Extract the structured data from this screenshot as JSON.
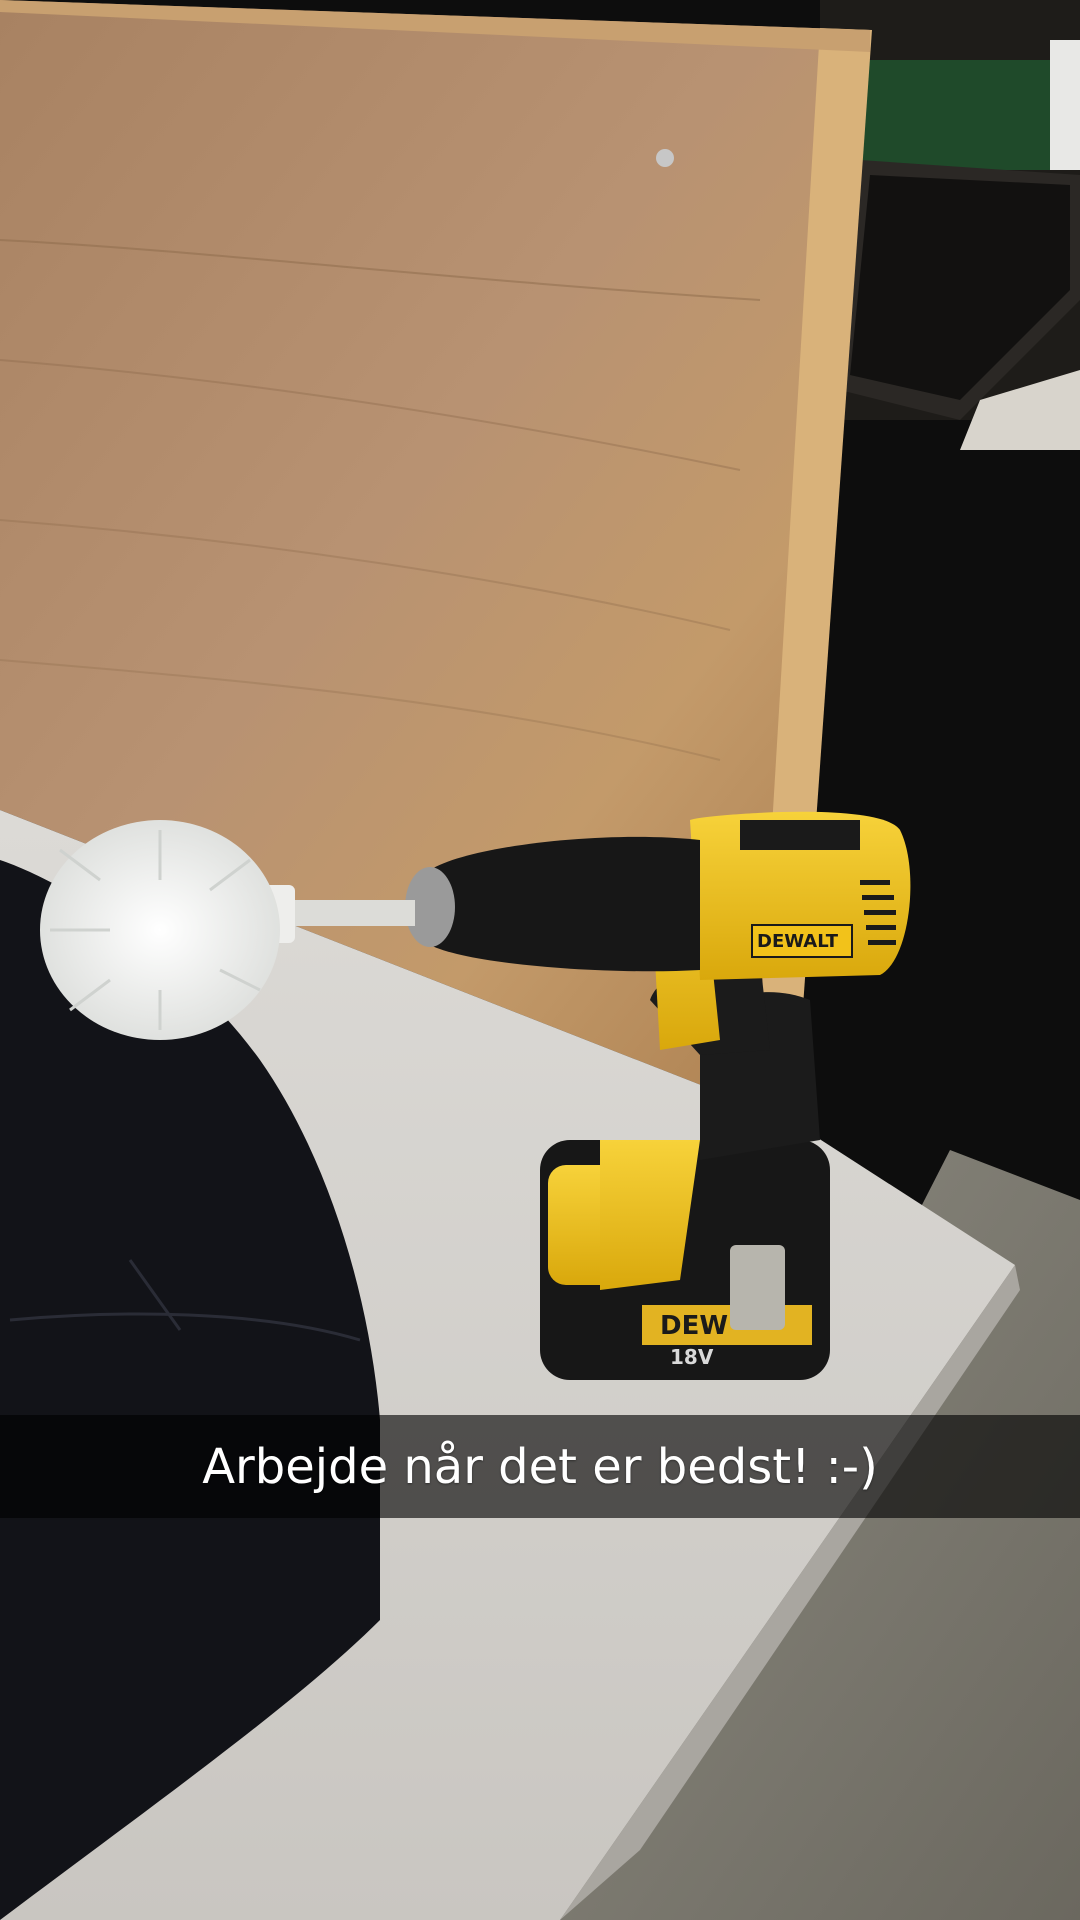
{
  "snap": {
    "caption": "Arbejde når det er bedst! :-)",
    "caption_bar_color": "#000000",
    "caption_text_color": "#ffffff"
  },
  "photo": {
    "brand_label": "DEWALT",
    "battery_brand_label": "DEW",
    "battery_voltage_label": "18V",
    "colors": {
      "plywood": "#b8916a",
      "tool_yellow": "#f2c21a",
      "tool_black": "#1a1a1a",
      "table_top": "#d9d7d2",
      "brush_white": "#f4f4f2",
      "background_dark": "#0d0d0d"
    },
    "icons": [
      "drill-icon",
      "battery-icon",
      "brush-icon"
    ]
  }
}
